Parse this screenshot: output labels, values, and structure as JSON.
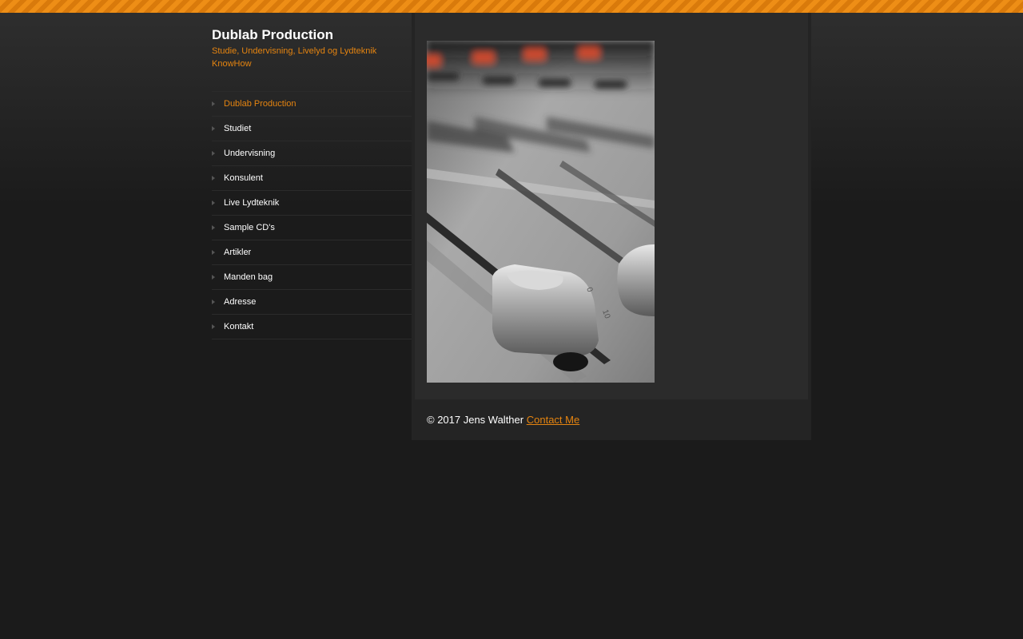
{
  "site": {
    "title": "Dublab Production",
    "tagline": "Studie, Undervisning, Livelyd og Lydteknik KnowHow"
  },
  "nav": {
    "items": [
      {
        "label": "Dublab Production",
        "active": true
      },
      {
        "label": "Studiet",
        "active": false
      },
      {
        "label": "Undervisning",
        "active": false
      },
      {
        "label": "Konsulent",
        "active": false
      },
      {
        "label": "Live Lydteknik",
        "active": false
      },
      {
        "label": "Sample CD's",
        "active": false
      },
      {
        "label": "Artikler",
        "active": false
      },
      {
        "label": "Manden bag",
        "active": false
      },
      {
        "label": "Adresse",
        "active": false
      },
      {
        "label": "Kontakt",
        "active": false
      }
    ]
  },
  "main": {
    "image": "mixing-console-faders-photo"
  },
  "footer": {
    "copyright": "© 2017 Jens Walther",
    "contact_link": "Contact Me"
  },
  "colors": {
    "accent": "#e58410",
    "background": "#1b1b1b",
    "content_panel": "#2b2b2b",
    "nav_text": "#ffffff"
  }
}
